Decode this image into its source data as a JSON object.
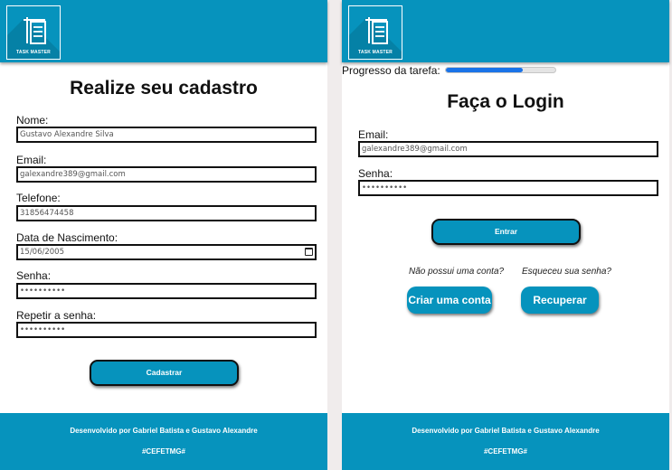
{
  "app": {
    "logo_text": "TASK MASTER",
    "accent_color": "#0693bd",
    "icons": [
      "list-logo-icon",
      "calendar-icon"
    ]
  },
  "register": {
    "title": "Realize seu cadastro",
    "fields": [
      {
        "label": "Nome:",
        "value": "Gustavo Alexandre Silva"
      },
      {
        "label": "Email:",
        "value": "galexandre389@gmail.com"
      },
      {
        "label": "Telefone:",
        "value": "31856474458"
      },
      {
        "label": "Data de Nascimento:",
        "value": "15/06/2005"
      },
      {
        "label": "Senha:",
        "value": "••••••••••"
      },
      {
        "label": "Repetir a senha:",
        "value": "••••••••••"
      }
    ],
    "submit_label": "Cadastrar"
  },
  "login": {
    "progress_label": "Progresso da tarefa:",
    "progress_value": 0.7,
    "title": "Faça o Login",
    "email_label": "Email:",
    "email_value": "galexandre389@gmail.com",
    "password_label": "Senha:",
    "password_value": "••••••••••",
    "submit_label": "Entrar",
    "no_account_text": "Não possui uma conta?",
    "forgot_text": "Esqueceu sua senha?",
    "create_account_label": "Criar uma conta",
    "recover_label": "Recuperar"
  },
  "footer": {
    "developed_by": "Desenvolvido por Gabriel Batista e Gustavo Alexandre",
    "hashtag": "#CEFETMG#"
  }
}
